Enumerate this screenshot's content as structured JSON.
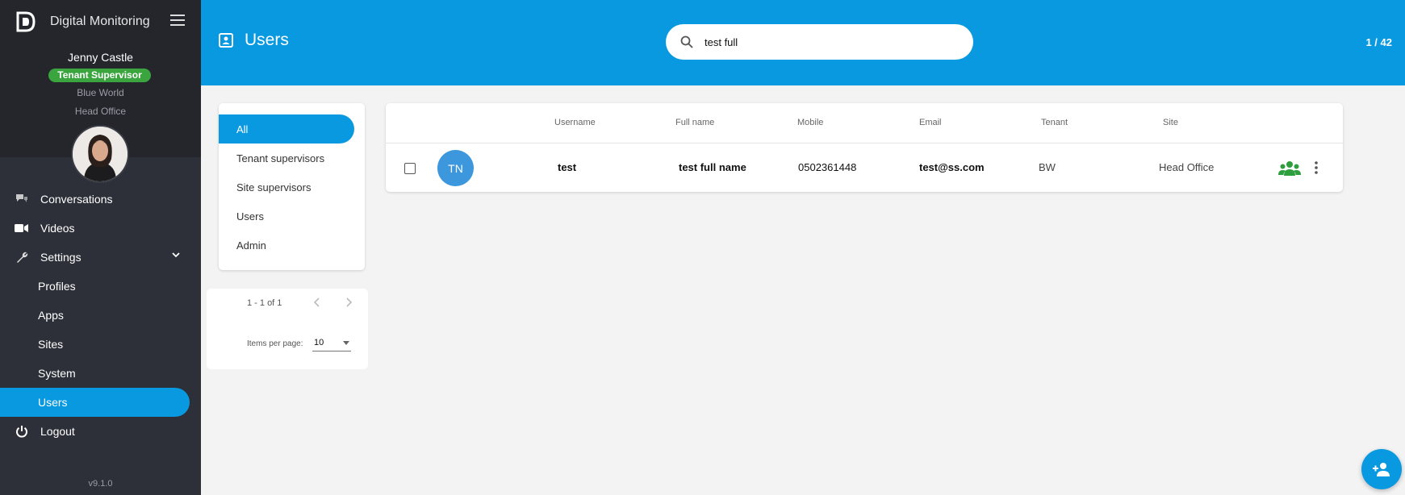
{
  "app": {
    "name": "Digital Monitoring",
    "version": "v9.1.0"
  },
  "profile": {
    "name": "Jenny Castle",
    "role": "Tenant Supervisor",
    "tenant": "Blue World",
    "site": "Head Office"
  },
  "nav": {
    "items": [
      {
        "label": "Conversations",
        "icon": "chat-icon"
      },
      {
        "label": "Videos",
        "icon": "video-icon"
      },
      {
        "label": "Settings",
        "icon": "wrench-icon"
      },
      {
        "label": "Profiles"
      },
      {
        "label": "Apps"
      },
      {
        "label": "Sites"
      },
      {
        "label": "System"
      },
      {
        "label": "Users"
      },
      {
        "label": "Logout",
        "icon": "power-icon"
      }
    ],
    "active": "Users"
  },
  "header": {
    "title": "Users",
    "search_value": "test full",
    "counter": "1 / 42"
  },
  "filters": {
    "items": [
      "All",
      "Tenant supervisors",
      "Site supervisors",
      "Users",
      "Admin"
    ],
    "active": "All"
  },
  "pager": {
    "range": "1 - 1 of 1",
    "items_per_page_label": "Items per page:",
    "items_per_page_value": "10"
  },
  "table": {
    "columns": [
      "Username",
      "Full name",
      "Mobile",
      "Email",
      "Tenant",
      "Site"
    ],
    "rows": [
      {
        "initials": "TN",
        "username": "test",
        "full_name": "test full name",
        "mobile": "0502361448",
        "email": "test@ss.com",
        "tenant": "BW",
        "site": "Head Office"
      }
    ]
  },
  "colors": {
    "primary": "#0899e0",
    "sidebar": "#2d3038",
    "badge": "#3aa53e",
    "group_icon": "#2e9e3e"
  }
}
